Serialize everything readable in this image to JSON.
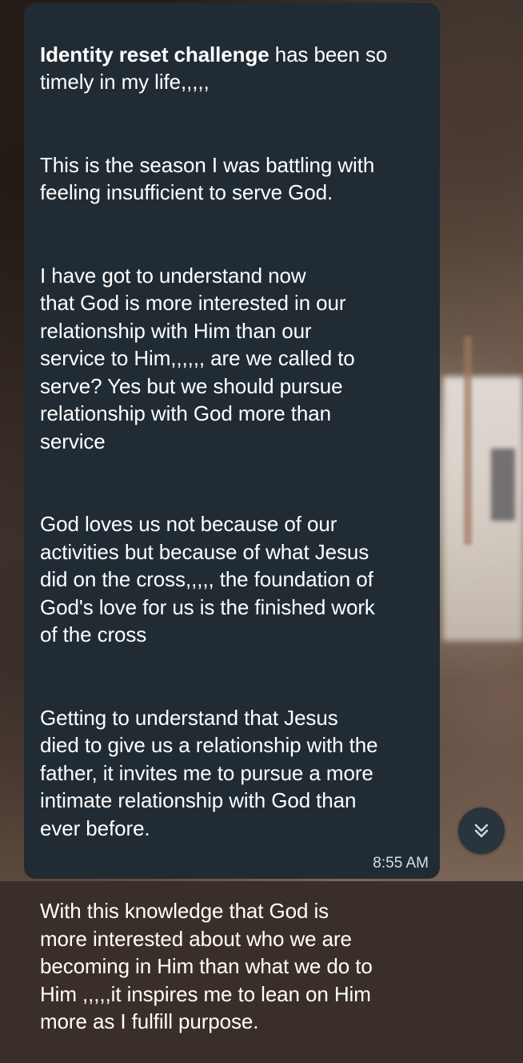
{
  "message": {
    "paragraphs": [
      {
        "bold": "Identity reset challenge",
        "text": " has been so\ntimely in my life,,,,,"
      },
      {
        "text": "This is the season I was battling with\nfeeling insufficient to serve God."
      },
      {
        "text": " I have got to understand now\nthat God is more interested in our\nrelationship with Him than our\nservice to Him,,,,,, are we called to\nserve? Yes but we should pursue\nrelationship with God more than\nservice"
      },
      {
        "text": "God loves us not because of our\nactivities but because of what Jesus\ndid on the cross,,,,, the foundation of\nGod's love for us is the finished work\nof the cross"
      },
      {
        "text": "Getting to understand that Jesus\ndied to give us a relationship with the\nfather, it invites me to pursue a more\nintimate relationship with God than\never before."
      },
      {
        "text": "With this knowledge that God is\nmore interested about who we are\nbecoming in Him than what we do to\nHim ,,,,,it inspires me to lean on Him\nmore as I fulfill purpose."
      }
    ],
    "timestamp": "8:55 AM"
  },
  "scroll_button": {
    "icon": "double-chevron-down-icon"
  },
  "colors": {
    "bubble": "#212b33",
    "text": "#ffffff",
    "timestamp": "#d7dee4",
    "scroll_button": "#2a343c"
  }
}
